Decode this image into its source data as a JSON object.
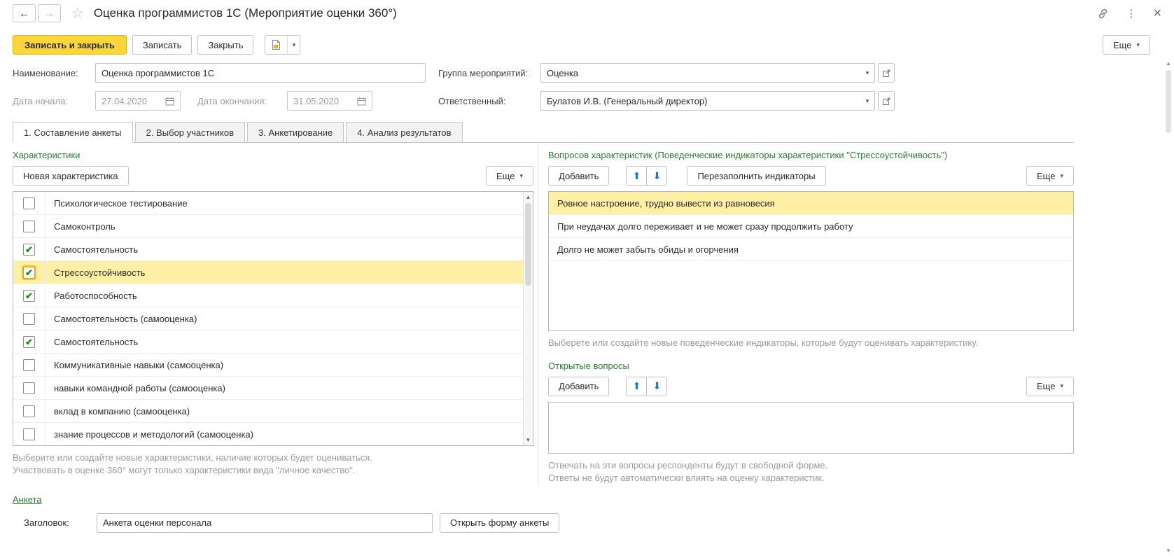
{
  "window": {
    "title": "Оценка программистов 1С (Мероприятие оценки 360°)"
  },
  "icons": {
    "back": "←",
    "forward": "→",
    "star": "☆",
    "menu_dots": "⋮",
    "close": "×",
    "dropdown": "▾",
    "up": "⬆",
    "down": "⬇",
    "scroll_up": "▲",
    "scroll_down": "▼",
    "check": "✔"
  },
  "colors": {
    "primary_button": "#FCD53C",
    "primary_button_border": "#DBB700",
    "selection_yellow": "#FFF0A6",
    "section_green": "#2E7D32",
    "arrow_blue": "#1B79CE",
    "check_green": "#1C8A1C",
    "hint_gray": "#9B9B9B"
  },
  "toolbar": {
    "save_close": "Записать и закрыть",
    "save": "Записать",
    "close": "Закрыть",
    "more": "Еще"
  },
  "fields": {
    "name": {
      "label": "Наименование:",
      "value": "Оценка программистов 1С"
    },
    "group": {
      "label": "Группа мероприятий:",
      "value": "Оценка"
    },
    "date_start": {
      "label": "Дата начала:",
      "value": "27.04.2020"
    },
    "date_end": {
      "label": "Дата окончания:",
      "value": "31.05.2020"
    },
    "responsible": {
      "label": "Ответственный:",
      "value": "Булатов И.В. (Генеральный директор)"
    }
  },
  "tabs": [
    {
      "label": "1. Составление анкеты",
      "active": true
    },
    {
      "label": "2. Выбор участников",
      "active": false
    },
    {
      "label": "3. Анкетирование",
      "active": false
    },
    {
      "label": "4. Анализ результатов",
      "active": false
    }
  ],
  "characteristics": {
    "title": "Характеристики",
    "new_button": "Новая характеристика",
    "more": "Еще",
    "items": [
      {
        "label": "Психологическое тестирование",
        "checked": false,
        "selected": false
      },
      {
        "label": "Самоконтроль",
        "checked": false,
        "selected": false
      },
      {
        "label": "Самостоятельность",
        "checked": true,
        "selected": false
      },
      {
        "label": "Стрессоустойчивость",
        "checked": true,
        "selected": true
      },
      {
        "label": "Работоспособность",
        "checked": true,
        "selected": false
      },
      {
        "label": "Самостоятельность (самооценка)",
        "checked": false,
        "selected": false
      },
      {
        "label": "Самостоятельность",
        "checked": true,
        "selected": false
      },
      {
        "label": "Коммуникативные навыки (самооценка)",
        "checked": false,
        "selected": false
      },
      {
        "label": "навыки командной работы (самооценка)",
        "checked": false,
        "selected": false
      },
      {
        "label": "вклад в компанию (самооценка)",
        "checked": false,
        "selected": false
      },
      {
        "label": "знание процессов и методологий (самооценка)",
        "checked": false,
        "selected": false
      }
    ],
    "hint_line1": "Выберите или создайте новые характеристики, наличие которых будет оцениваться.",
    "hint_line2": "Участвовать в оценке 360° могут только характеристики вида \"личное качество\"."
  },
  "questions": {
    "title": "Вопросов характеристик (Поведенческие индикаторы характеристики \"Стрессоустойчивость\")",
    "add_button": "Добавить",
    "refill_button": "Перезаполнить индикаторы",
    "more": "Еще",
    "items": [
      {
        "label": "Ровное настроение, трудно вывести из равновесия",
        "selected": true
      },
      {
        "label": "При неудачах долго переживает и не может сразу продолжить работу",
        "selected": false
      },
      {
        "label": "Долго не может забыть обиды и огорчения",
        "selected": false
      }
    ],
    "hint": "Выберете или создайте новые поведенческие индикаторы, которые будут оценивать характеристику."
  },
  "open_questions": {
    "title": "Открытые вопросы",
    "add_button": "Добавить",
    "more": "Еще",
    "hint_line1": "Отвечать на эти вопросы респонденты будут в свободной форме.",
    "hint_line2": "Ответы не будут автоматически влиять на оценку характеристик."
  },
  "questionnaire": {
    "link": "Анкета",
    "header_label": "Заголовок:",
    "header_value": "Анкета оценки персонала",
    "open_form_button": "Открыть форму анкеты"
  }
}
